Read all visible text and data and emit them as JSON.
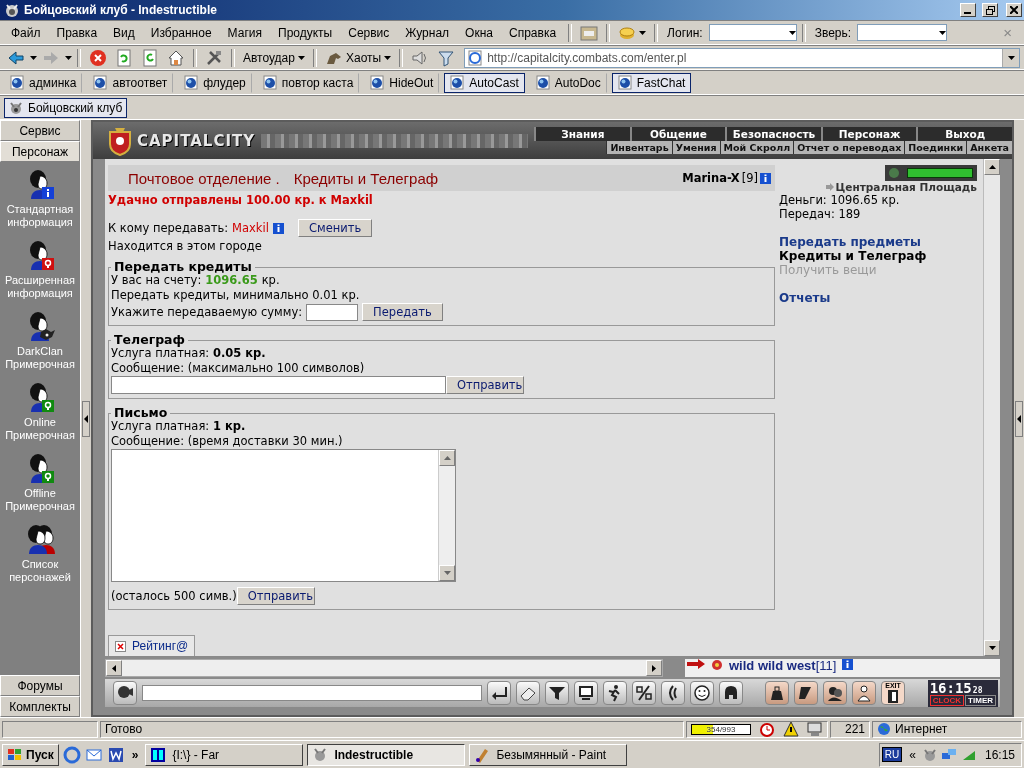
{
  "window": {
    "title": "Бойцовский клуб - Indestructible"
  },
  "menu": [
    "Файл",
    "Правка",
    "Вид",
    "Избранное",
    "Магия",
    "Продукты",
    "Сервис",
    "Журнал",
    "Окна",
    "Справка"
  ],
  "login": {
    "label": "Логин:"
  },
  "pet": {
    "label": "Зверь:"
  },
  "menu_close": "×",
  "toolbar": {
    "autohit": "Автоудар",
    "chaos": "Хаоты"
  },
  "address": {
    "value": "http://capitalcity.combats.com/enter.pl"
  },
  "plugins": [
    {
      "label": "админка",
      "selected": false
    },
    {
      "label": "автоответ",
      "selected": false
    },
    {
      "label": "флудер",
      "selected": false
    },
    {
      "label": "повтор каста",
      "selected": false
    },
    {
      "label": "HideOut",
      "selected": false
    },
    {
      "label": "AutoCast",
      "selected": true
    },
    {
      "label": "AutoDoc",
      "selected": false
    },
    {
      "label": "FastChat",
      "selected": true
    }
  ],
  "tabs": [
    {
      "label": "Бойцовский клуб",
      "selected": true
    }
  ],
  "sidebar": {
    "top": [
      {
        "label": "Сервис",
        "expanded": false
      },
      {
        "label": "Персонаж",
        "expanded": true
      }
    ],
    "items": [
      {
        "label": "Стандартная информация",
        "kind": "info"
      },
      {
        "label": "Расширенная информация",
        "kind": "extended"
      },
      {
        "label": "DarkClan Примерочная",
        "kind": "clan"
      },
      {
        "label": "Online Примерочная",
        "kind": "online"
      },
      {
        "label": "Offline Примерочная",
        "kind": "offline"
      },
      {
        "label": "Список персонажей",
        "kind": "list"
      }
    ],
    "bottom": [
      {
        "label": "Форумы",
        "expanded": false
      },
      {
        "label": "Комплекты",
        "expanded": false
      }
    ]
  },
  "game": {
    "logo": "CAPITALCITY",
    "nav_top": [
      "Знания",
      "Общение",
      "Безопасность",
      "Персонаж",
      "Выход"
    ],
    "nav_bottom": [
      "Инвентарь",
      "Умения",
      "Мой Скролл",
      "Отчет о переводах",
      "Поединки",
      "Анкета"
    ],
    "title": [
      "Почтовое отделение .",
      "Кредиты и Телеграф"
    ],
    "user": {
      "name": "Marina-X",
      "rank": "[9]"
    },
    "success": "Удачно отправлены 100.00 кр. к Maxkil",
    "recipient": {
      "label": "К кому передавать:",
      "name": "Maxkil",
      "button": "Сменить"
    },
    "location_note": "Находится в этом городе",
    "credits": {
      "legend": "Передать кредиты",
      "balance_label": "У вас на счету:",
      "balance": "1096.65",
      "currency": "кр.",
      "minimum": "Передать кредиты, минимально 0.01 кр.",
      "amount_label": "Укажите передаваемую сумму:",
      "button": "Передать"
    },
    "telegraph": {
      "legend": "Телеграф",
      "fee": "Услуга платная: **0.05 кр.**",
      "message": "Сообщение: (максимально 100 символов)",
      "button": "Отправить"
    },
    "letter": {
      "legend": "Письмо",
      "fee": "Услуга платная: **1 кр.**",
      "message": "Сообщение: (время доставки 30 мин.)",
      "remaining": "(осталось 500 симв.)",
      "button": "Отправить"
    },
    "side": {
      "place": "Центральная Площадь",
      "money": "Деньги: 1096.65 кр.",
      "transfers": "Передач: 189",
      "link_groups": [
        [
          {
            "label": "Передать предметы",
            "kind": "link"
          },
          {
            "label": "Кредиты и Телеграф",
            "kind": "current"
          },
          {
            "label": "Получить вещи",
            "kind": "disabled"
          }
        ],
        [
          {
            "label": "Отчеты",
            "kind": "link"
          }
        ]
      ]
    },
    "frame_tabs": [
      {
        "label": "Рейтинг@",
        "selected": true
      }
    ],
    "chat_peek": {
      "name": "wild wild west",
      "rank": "[11]"
    },
    "clock": {
      "exit": "EXIT",
      "time": "16:15",
      "seconds": "28",
      "clock": "CLOCK",
      "timer": "TIMER"
    }
  },
  "status": {
    "text": "Готово",
    "progress": {
      "level": 0.36,
      "reading": "354/993"
    },
    "count": "221",
    "zone": "Интернет"
  },
  "taskbar": {
    "start": "Пуск",
    "quick_more": "»",
    "tasks": [
      {
        "label": "{I:\\} - Far",
        "selected": false
      },
      {
        "label": "Indestructible",
        "selected": true
      },
      {
        "label": "Безымянный - Paint",
        "selected": false
      }
    ],
    "lang": "RU",
    "tray_more": "«",
    "time": "16:15"
  }
}
